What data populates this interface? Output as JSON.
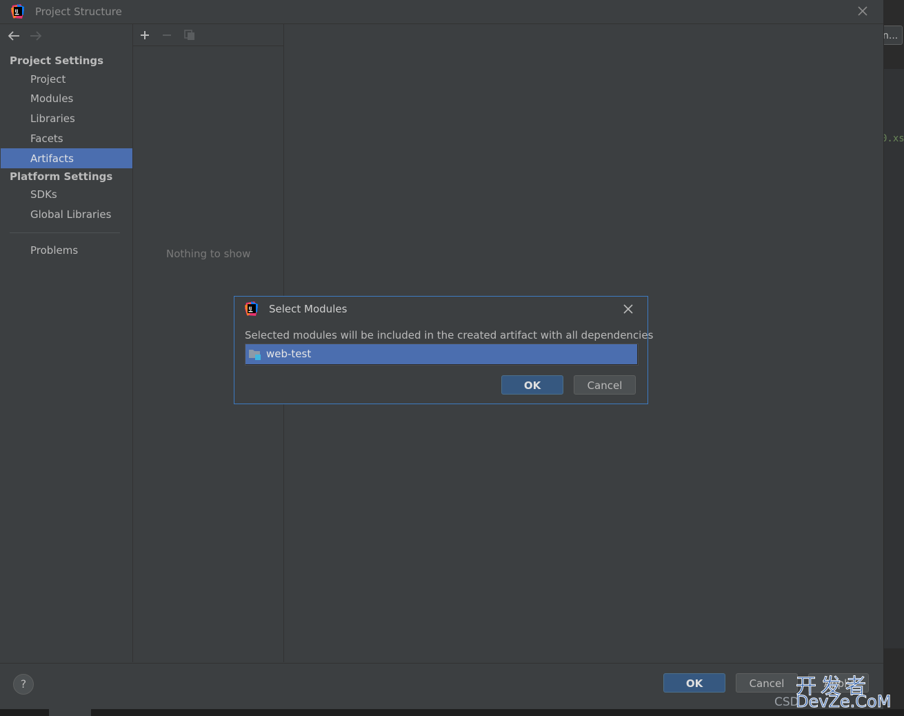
{
  "window": {
    "title": "Project Structure"
  },
  "nav": {
    "project_settings": "Project Settings",
    "items_project": [
      "Project",
      "Modules",
      "Libraries",
      "Facets",
      "Artifacts"
    ],
    "selected": "Artifacts",
    "platform_settings": "Platform Settings",
    "items_platform": [
      "SDKs",
      "Global Libraries"
    ],
    "problems": "Problems"
  },
  "middle": {
    "empty_text": "Nothing to show"
  },
  "footer": {
    "help_label": "?",
    "ok_label": "OK",
    "cancel_label": "Cancel",
    "apply_label": "Apply"
  },
  "modal": {
    "title": "Select Modules",
    "description": "Selected modules will be included in the created artifact with all dependencies",
    "modules": [
      "web-test"
    ],
    "ok_label": "OK",
    "cancel_label": "Cancel"
  },
  "background_editor": {
    "button_text": "n...",
    "code_snippet": "0.xs"
  },
  "watermark": {
    "top": "开发者",
    "bottom": "DevZe.CoM",
    "csdn": "CSD"
  },
  "colors": {
    "selection": "#4b6eaf",
    "modal_border": "#3d7bc3",
    "primary_button": "#365880"
  }
}
